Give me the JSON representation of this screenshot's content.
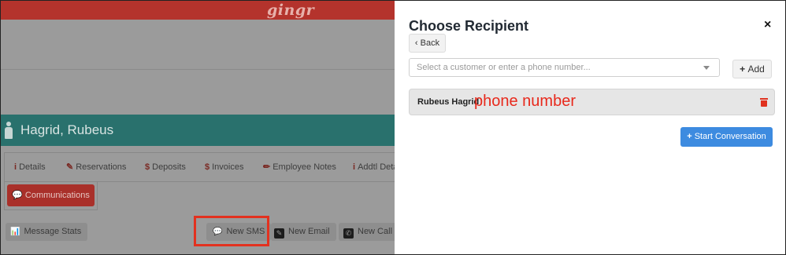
{
  "app": {
    "brand": "gingr",
    "person_name": "Hagrid, Rubeus"
  },
  "tabs": [
    {
      "icon": "i",
      "label": "Details"
    },
    {
      "icon": "✎",
      "label": "Reservations"
    },
    {
      "icon": "$",
      "label": "Deposits"
    },
    {
      "icon": "$",
      "label": "Invoices"
    },
    {
      "icon": "✏",
      "label": "Employee Notes"
    },
    {
      "icon": "i",
      "label": "Addtl Deta"
    }
  ],
  "communications_label": "Communications",
  "actions": {
    "message_stats": "Message Stats",
    "new_sms": "New SMS",
    "new_email": "New Email",
    "new_call": "New Call R"
  },
  "panel": {
    "title": "Choose Recipient",
    "close": "×",
    "back_label": "Back",
    "select_placeholder": "Select a customer or enter a phone number...",
    "add_label": "Add",
    "recipient_name": "Rubeus Hagrid",
    "recipient_phone": "phone number",
    "start_label": "Start Conversation"
  },
  "colors": {
    "accent_blue": "#3d8be0",
    "danger_red": "#e0321f",
    "teal": "#29716d",
    "brand_red": "#b4332c"
  }
}
